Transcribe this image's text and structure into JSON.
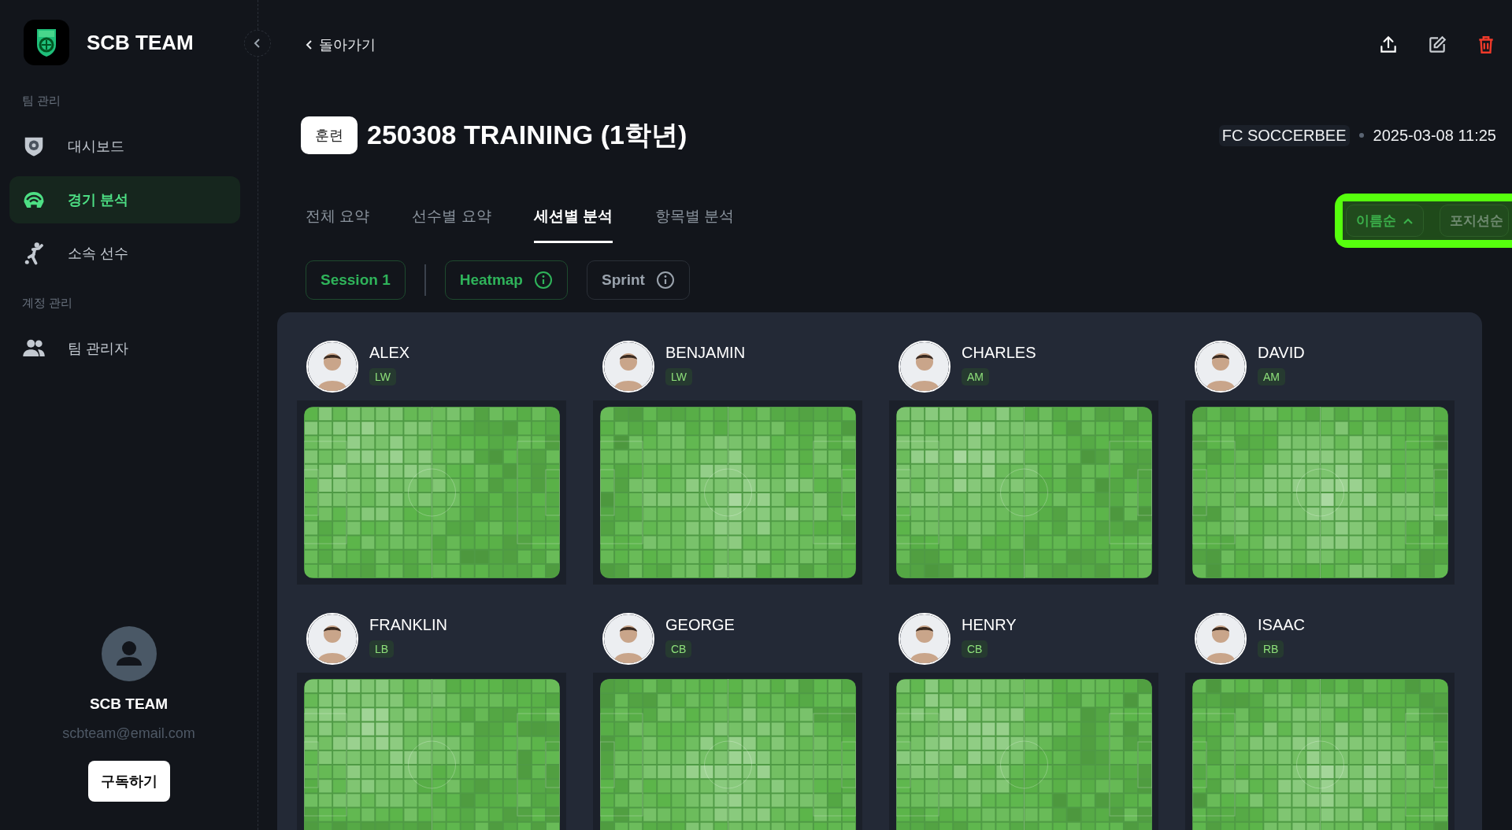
{
  "sidebar": {
    "brand": "SCB TEAM",
    "sections": [
      {
        "label": "팀 관리",
        "items": [
          {
            "label": "대시보드",
            "selected": false
          },
          {
            "label": "경기 분석",
            "selected": true
          },
          {
            "label": "소속 선수",
            "selected": false
          }
        ]
      },
      {
        "label": "계정 관리",
        "items": [
          {
            "label": "팀 관리자",
            "selected": false
          }
        ]
      }
    ],
    "profile": {
      "name": "SCB TEAM",
      "email": "scbteam@email.com",
      "button": "구독하기"
    }
  },
  "header": {
    "back": "돌아가기",
    "badge": "훈련",
    "title": "250308 TRAINING (1학년)",
    "team": "FC SOCCERBEE",
    "datetime": "2025-03-08 11:25"
  },
  "tabs": [
    {
      "label": "전체 요약",
      "selected": false
    },
    {
      "label": "선수별 요약",
      "selected": false
    },
    {
      "label": "세션별 분석",
      "selected": true
    },
    {
      "label": "항목별 분석",
      "selected": false
    }
  ],
  "sort": {
    "highlighted": true,
    "options": [
      {
        "label": "이름순",
        "selected": true
      },
      {
        "label": "포지션순",
        "selected": false
      }
    ]
  },
  "session": {
    "label": "Session 1",
    "selected": true
  },
  "metrics": [
    {
      "label": "Heatmap",
      "selected": true
    },
    {
      "label": "Sprint",
      "selected": false
    }
  ],
  "players": [
    {
      "name": "ALEX",
      "position": "LW"
    },
    {
      "name": "BENJAMIN",
      "position": "LW"
    },
    {
      "name": "CHARLES",
      "position": "AM"
    },
    {
      "name": "DAVID",
      "position": "AM"
    },
    {
      "name": "FRANKLIN",
      "position": "LB"
    },
    {
      "name": "GEORGE",
      "position": "CB"
    },
    {
      "name": "HENRY",
      "position": "CB"
    },
    {
      "name": "ISAAC",
      "position": "RB"
    }
  ]
}
